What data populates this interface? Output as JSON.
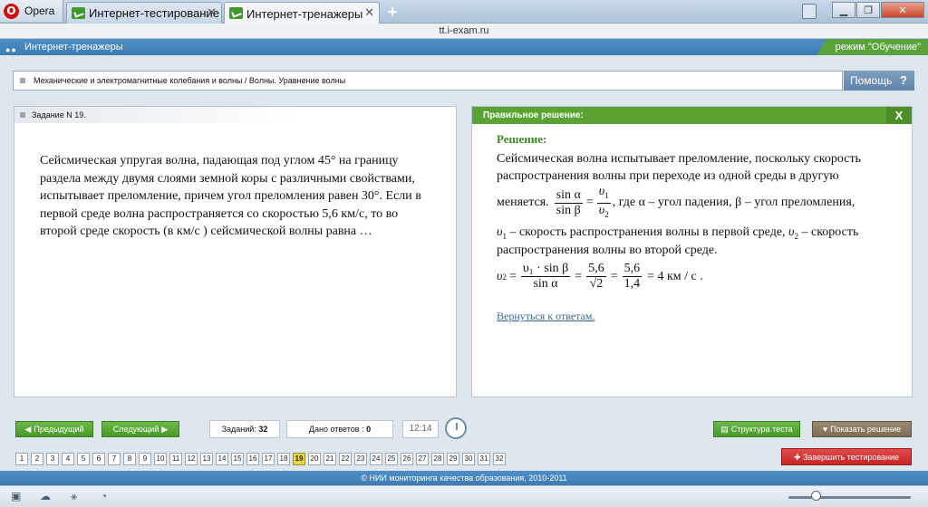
{
  "browser": {
    "menu_label": "Opera",
    "tabs": [
      {
        "title": "Интернет-тестирование",
        "active": false
      },
      {
        "title": "Интернет-тренажеры",
        "active": true
      }
    ],
    "address": "tt.i-exam.ru"
  },
  "app": {
    "header_title": "Интернет-тренажеры",
    "mode": "режим \"Обучение\"",
    "topic": "Механические и электромагнитные колебания и волны / Волны. Уравнение волны",
    "help_label": "Помощь",
    "help_symbol": "?"
  },
  "task": {
    "header": "Задание N 19.",
    "text": "Сейсмическая упругая волна, падающая под углом 45° на границу раздела между двумя слоями земной коры с различными свойствами, испытывает преломление, причем угол преломления равен 30°. Если в первой среде волна распространяется со скоростью 5,6 км/с, то во второй среде скорость (в км/с ) сейсмической волны равна …"
  },
  "solution": {
    "header": "Правильное решение:",
    "close_label": "X",
    "heading": "Решение:",
    "line1": "Сейсмическая волна испытывает преломление, поскольку скорость",
    "line2": "распространения волны при переходе из одной среды в другую",
    "line3_start": "меняется.",
    "f1_num_left": "sin α",
    "f1_den_left": "sin β",
    "f1_num_right": "υ",
    "f1_num_right_sub": "1",
    "f1_den_right": "υ",
    "f1_den_right_sub": "2",
    "line3_end": ", где α – угол падения,  β – угол преломления,",
    "line4_v1": "υ",
    "line4_v1_sub": "1",
    "line4_mid": " – скорость распространения волны в первой среде, ",
    "line4_v2": "υ",
    "line4_v2_sub": "2",
    "line4_end": " –  скорость",
    "line5": "распространения волны во второй среде.",
    "f2_lhs": "υ",
    "f2_lhs_sub": "2",
    "f2_num1": "υ₁ · sin β",
    "f2_den1": "sin α",
    "f2_num2": "5,6",
    "f2_den2": "√2",
    "f2_num3": "5,6",
    "f2_den3": "1,4",
    "f2_result": "= 4 км / с .",
    "back_link": "Вернуться к ответам."
  },
  "toolbar": {
    "prev_label": "Предыдущий",
    "next_label": "Следующий",
    "tasks_label": "Заданий:",
    "tasks_count": "32",
    "answers_label": "Дано ответов :",
    "answers_count": "0",
    "timer": "12:14",
    "structure_label": "Структура теста",
    "show_solution_label": "Показать решение",
    "finish_label": "Завершить тестирование",
    "current_task": "19",
    "task_numbers": [
      "1",
      "2",
      "3",
      "4",
      "5",
      "6",
      "7",
      "8",
      "9",
      "10",
      "11",
      "12",
      "13",
      "14",
      "15",
      "16",
      "17",
      "18",
      "19",
      "20",
      "21",
      "22",
      "23",
      "24",
      "25",
      "26",
      "27",
      "28",
      "29",
      "30",
      "31",
      "32"
    ]
  },
  "footer": "© НИИ мониторинга качества образования, 2010-2011",
  "colors": {
    "accent_green": "#5aa332",
    "header_blue": "#3d7bb4",
    "current_number": "#e8d64a",
    "finish_red": "#c52525"
  }
}
